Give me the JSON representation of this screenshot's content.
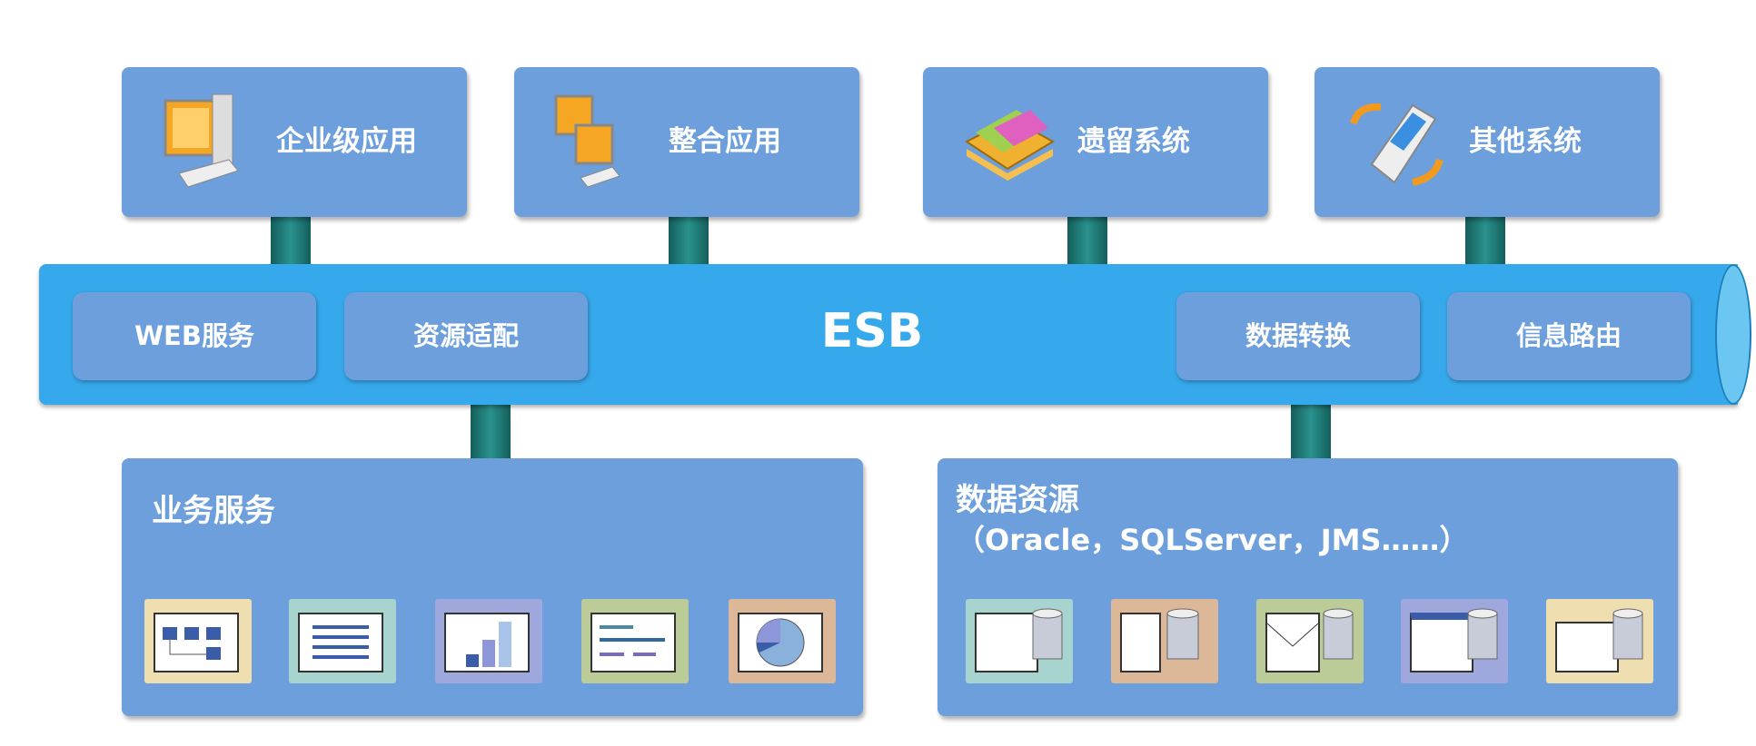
{
  "systems": [
    {
      "label": "企业级应用",
      "icon": "computer-icon"
    },
    {
      "label": "整合应用",
      "icon": "computers-icon"
    },
    {
      "label": "遗留系统",
      "icon": "folders-icon"
    },
    {
      "label": "其他系统",
      "icon": "mobile-device-icon"
    }
  ],
  "bus": {
    "title": "ESB",
    "functions": [
      "WEB服务",
      "资源适配",
      "数据转换",
      "信息路由"
    ]
  },
  "business": {
    "title": "业务服务",
    "icons": [
      "flowchart-icon",
      "list-icon",
      "bar-chart-icon",
      "gantt-icon",
      "pie-chart-icon"
    ]
  },
  "data": {
    "title": "数据资源",
    "subtitle": "（Oracle，SQLServer，JMS……）",
    "icons": [
      "table-database-icon",
      "document-database-icon",
      "mail-database-icon",
      "form-database-icon",
      "report-database-icon"
    ]
  },
  "colors": {
    "box": "#6c9fdc",
    "bus": "#36a8ec",
    "connector": "#1e7a78"
  }
}
